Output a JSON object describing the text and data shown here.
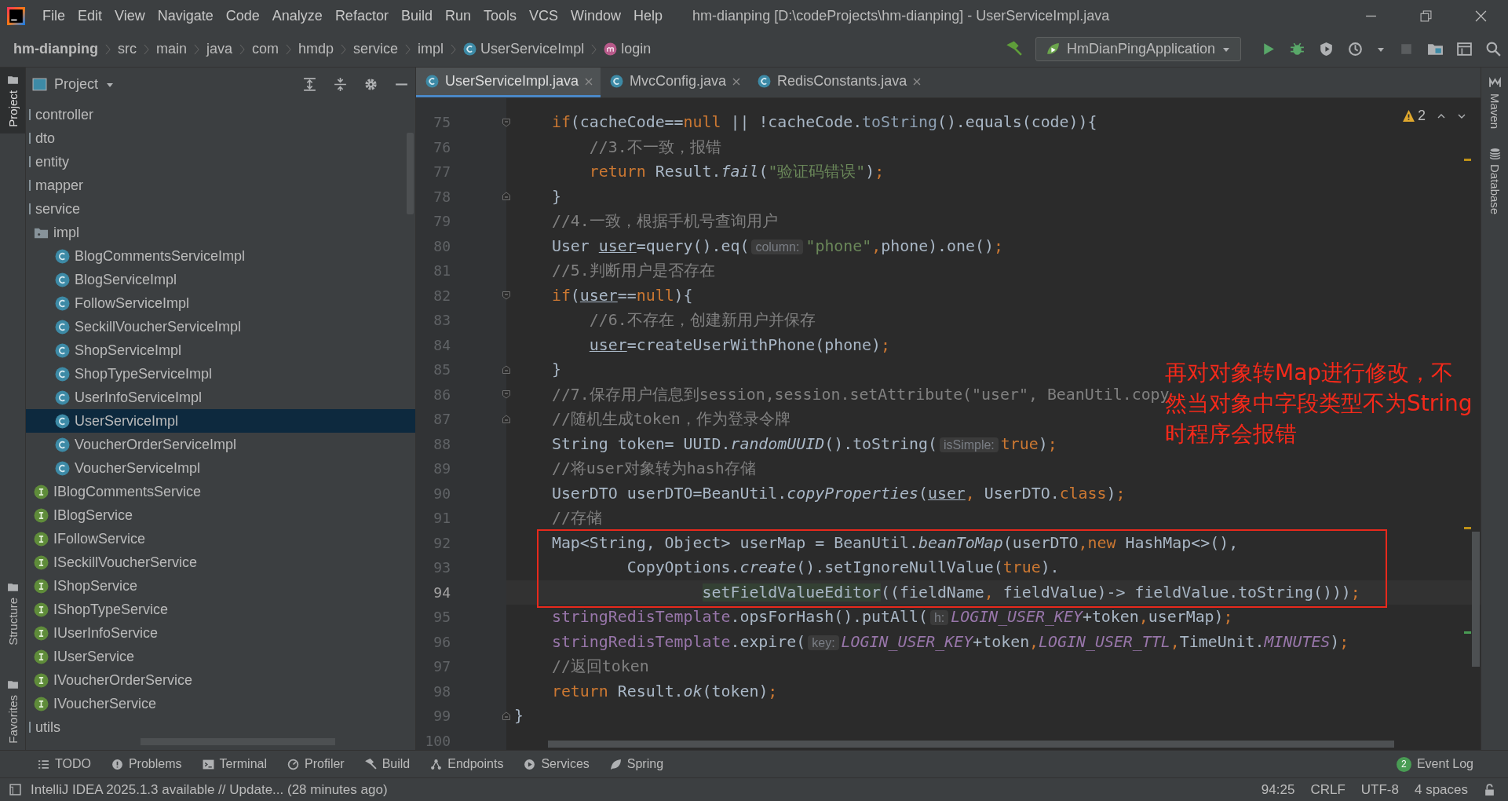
{
  "menu_bar": {
    "items": [
      "File",
      "Edit",
      "View",
      "Navigate",
      "Code",
      "Analyze",
      "Refactor",
      "Build",
      "Run",
      "Tools",
      "VCS",
      "Window",
      "Help"
    ],
    "title": "hm-dianping [D:\\codeProjects\\hm-dianping] - UserServiceImpl.java"
  },
  "breadcrumb": [
    {
      "label": "hm-dianping",
      "kind": "project"
    },
    {
      "label": "src",
      "kind": "folder"
    },
    {
      "label": "main",
      "kind": "folder"
    },
    {
      "label": "java",
      "kind": "folder"
    },
    {
      "label": "com",
      "kind": "folder"
    },
    {
      "label": "hmdp",
      "kind": "folder"
    },
    {
      "label": "service",
      "kind": "folder"
    },
    {
      "label": "impl",
      "kind": "folder"
    },
    {
      "label": "UserServiceImpl",
      "kind": "class"
    },
    {
      "label": "login",
      "kind": "method"
    }
  ],
  "run_configuration": {
    "label": "HmDianPingApplication"
  },
  "left_tool_strip": [
    {
      "label": "Project",
      "selected": true
    },
    {
      "label": "Structure",
      "selected": false
    },
    {
      "label": "Favorites",
      "selected": false
    }
  ],
  "project_panel": {
    "title": "Project",
    "tree": [
      {
        "label": "controller",
        "kind": "package",
        "selected": false
      },
      {
        "label": "dto",
        "kind": "package",
        "selected": false
      },
      {
        "label": "entity",
        "kind": "package",
        "selected": false
      },
      {
        "label": "mapper",
        "kind": "package",
        "selected": false
      },
      {
        "label": "service",
        "kind": "package",
        "selected": false,
        "children": [
          {
            "label": "impl",
            "kind": "folder",
            "selected": false,
            "children": [
              {
                "label": "BlogCommentsServiceImpl",
                "kind": "class",
                "selected": false
              },
              {
                "label": "BlogServiceImpl",
                "kind": "class",
                "selected": false
              },
              {
                "label": "FollowServiceImpl",
                "kind": "class",
                "selected": false
              },
              {
                "label": "SeckillVoucherServiceImpl",
                "kind": "class",
                "selected": false
              },
              {
                "label": "ShopServiceImpl",
                "kind": "class",
                "selected": false
              },
              {
                "label": "ShopTypeServiceImpl",
                "kind": "class",
                "selected": false
              },
              {
                "label": "UserInfoServiceImpl",
                "kind": "class",
                "selected": false
              },
              {
                "label": "UserServiceImpl",
                "kind": "class",
                "selected": true
              },
              {
                "label": "VoucherOrderServiceImpl",
                "kind": "class",
                "selected": false
              },
              {
                "label": "VoucherServiceImpl",
                "kind": "class",
                "selected": false
              }
            ]
          },
          {
            "label": "IBlogCommentsService",
            "kind": "interface",
            "selected": false
          },
          {
            "label": "IBlogService",
            "kind": "interface",
            "selected": false
          },
          {
            "label": "IFollowService",
            "kind": "interface",
            "selected": false
          },
          {
            "label": "ISeckillVoucherService",
            "kind": "interface",
            "selected": false
          },
          {
            "label": "IShopService",
            "kind": "interface",
            "selected": false
          },
          {
            "label": "IShopTypeService",
            "kind": "interface",
            "selected": false
          },
          {
            "label": "IUserInfoService",
            "kind": "interface",
            "selected": false
          },
          {
            "label": "IUserService",
            "kind": "interface",
            "selected": false
          },
          {
            "label": "IVoucherOrderService",
            "kind": "interface",
            "selected": false
          },
          {
            "label": "IVoucherService",
            "kind": "interface",
            "selected": false
          }
        ]
      },
      {
        "label": "utils",
        "kind": "package",
        "selected": false
      }
    ]
  },
  "editor_tabs": [
    {
      "label": "UserServiceImpl.java",
      "selected": true
    },
    {
      "label": "MvcConfig.java",
      "selected": false
    },
    {
      "label": "RedisConstants.java",
      "selected": false
    }
  ],
  "editor": {
    "warning_count": "2",
    "lines": [
      {
        "number": "75",
        "fold_start": true,
        "fold_end": false,
        "current": false,
        "boxed": false,
        "tokens": [
          {
            "kind": "keyword",
            "text": "    if"
          },
          {
            "kind": "plain",
            "text": "(cacheCode=="
          },
          {
            "kind": "keyword",
            "text": "null"
          },
          {
            "kind": "plain",
            "text": " || !cacheCode."
          },
          {
            "kind": "dim",
            "text": "toString"
          },
          {
            "kind": "plain",
            "text": "().equals(code)){"
          }
        ]
      },
      {
        "number": "76",
        "fold_start": false,
        "fold_end": false,
        "current": false,
        "boxed": false,
        "tokens": [
          {
            "kind": "comment",
            "text": "        //3.不一致，报错"
          }
        ]
      },
      {
        "number": "77",
        "fold_start": false,
        "fold_end": false,
        "current": false,
        "boxed": false,
        "tokens": [
          {
            "kind": "keyword",
            "text": "        return"
          },
          {
            "kind": "plain",
            "text": " Result."
          },
          {
            "kind": "italic",
            "text": "fail"
          },
          {
            "kind": "plain",
            "text": "("
          },
          {
            "kind": "string",
            "text": "\"验证码错误\""
          },
          {
            "kind": "plain",
            "text": ")"
          },
          {
            "kind": "keyword",
            "text": ";"
          }
        ]
      },
      {
        "number": "78",
        "fold_start": false,
        "fold_end": true,
        "current": false,
        "boxed": false,
        "tokens": [
          {
            "kind": "plain",
            "text": "    }"
          }
        ]
      },
      {
        "number": "79",
        "fold_start": false,
        "fold_end": false,
        "current": false,
        "boxed": false,
        "tokens": [
          {
            "kind": "comment",
            "text": "    //4.一致，根据手机号查询用户"
          }
        ]
      },
      {
        "number": "80",
        "fold_start": false,
        "fold_end": false,
        "current": false,
        "boxed": false,
        "tokens": [
          {
            "kind": "plain",
            "text": "    User "
          },
          {
            "kind": "underline",
            "text": "user"
          },
          {
            "kind": "plain",
            "text": "=query().eq("
          },
          {
            "kind": "hint",
            "text": "column:"
          },
          {
            "kind": "string",
            "text": "\"phone\""
          },
          {
            "kind": "keyword",
            "text": ","
          },
          {
            "kind": "plain",
            "text": "phone).one()"
          },
          {
            "kind": "keyword",
            "text": ";"
          }
        ]
      },
      {
        "number": "81",
        "fold_start": false,
        "fold_end": false,
        "current": false,
        "boxed": false,
        "tokens": [
          {
            "kind": "comment",
            "text": "    //5.判断用户是否存在"
          }
        ]
      },
      {
        "number": "82",
        "fold_start": true,
        "fold_end": false,
        "current": false,
        "boxed": false,
        "tokens": [
          {
            "kind": "keyword",
            "text": "    if"
          },
          {
            "kind": "plain",
            "text": "("
          },
          {
            "kind": "underline",
            "text": "user"
          },
          {
            "kind": "plain",
            "text": "=="
          },
          {
            "kind": "keyword",
            "text": "null"
          },
          {
            "kind": "plain",
            "text": "){"
          }
        ]
      },
      {
        "number": "83",
        "fold_start": false,
        "fold_end": false,
        "current": false,
        "boxed": false,
        "tokens": [
          {
            "kind": "comment",
            "text": "        //6.不存在，创建新用户并保存"
          }
        ]
      },
      {
        "number": "84",
        "fold_start": false,
        "fold_end": false,
        "current": false,
        "boxed": false,
        "tokens": [
          {
            "kind": "underline",
            "text": "        user"
          },
          {
            "kind": "plain",
            "text": "=createUserWithPhone(phone)"
          },
          {
            "kind": "keyword",
            "text": ";"
          }
        ]
      },
      {
        "number": "85",
        "fold_start": false,
        "fold_end": true,
        "current": false,
        "boxed": false,
        "tokens": [
          {
            "kind": "plain",
            "text": "    }"
          }
        ]
      },
      {
        "number": "86",
        "fold_start": true,
        "fold_end": false,
        "current": false,
        "boxed": false,
        "tokens": [
          {
            "kind": "comment",
            "text": "    //7.保存用户信息到session,session.setAttribute(\"user\", BeanUtil.copy"
          }
        ]
      },
      {
        "number": "87",
        "fold_start": false,
        "fold_end": true,
        "current": false,
        "boxed": false,
        "tokens": [
          {
            "kind": "comment",
            "text": "    //随机生成token，作为登录令牌"
          }
        ]
      },
      {
        "number": "88",
        "fold_start": false,
        "fold_end": false,
        "current": false,
        "boxed": false,
        "tokens": [
          {
            "kind": "plain",
            "text": "    String token= UUID."
          },
          {
            "kind": "italic",
            "text": "randomUUID"
          },
          {
            "kind": "plain",
            "text": "().toString("
          },
          {
            "kind": "hint",
            "text": "isSimple:"
          },
          {
            "kind": "keyword",
            "text": "true"
          },
          {
            "kind": "plain",
            "text": ")"
          },
          {
            "kind": "keyword",
            "text": ";"
          }
        ]
      },
      {
        "number": "89",
        "fold_start": false,
        "fold_end": false,
        "current": false,
        "boxed": false,
        "tokens": [
          {
            "kind": "comment",
            "text": "    //将user对象转为hash存储"
          }
        ]
      },
      {
        "number": "90",
        "fold_start": false,
        "fold_end": false,
        "current": false,
        "boxed": false,
        "tokens": [
          {
            "kind": "plain",
            "text": "    UserDTO userDTO=BeanUtil."
          },
          {
            "kind": "italic",
            "text": "copyProperties"
          },
          {
            "kind": "plain",
            "text": "("
          },
          {
            "kind": "underline",
            "text": "user"
          },
          {
            "kind": "keyword",
            "text": ","
          },
          {
            "kind": "plain",
            "text": " UserDTO."
          },
          {
            "kind": "keyword",
            "text": "class"
          },
          {
            "kind": "plain",
            "text": ")"
          },
          {
            "kind": "keyword",
            "text": ";"
          }
        ]
      },
      {
        "number": "91",
        "fold_start": false,
        "fold_end": false,
        "current": false,
        "boxed": false,
        "tokens": [
          {
            "kind": "comment",
            "text": "    //存储"
          }
        ]
      },
      {
        "number": "92",
        "fold_start": false,
        "fold_end": false,
        "current": false,
        "boxed": true,
        "tokens": [
          {
            "kind": "plain",
            "text": "    Map<String, Object> userMap = BeanUtil."
          },
          {
            "kind": "italic",
            "text": "beanToMap"
          },
          {
            "kind": "plain",
            "text": "(userDTO"
          },
          {
            "kind": "keyword",
            "text": ",new"
          },
          {
            "kind": "plain",
            "text": " HashMap<>(),"
          }
        ]
      },
      {
        "number": "93",
        "fold_start": false,
        "fold_end": false,
        "current": false,
        "boxed": true,
        "tokens": [
          {
            "kind": "plain",
            "text": "            CopyOptions."
          },
          {
            "kind": "italic",
            "text": "create"
          },
          {
            "kind": "plain",
            "text": "().setIgnoreNullValue("
          },
          {
            "kind": "keyword",
            "text": "true"
          },
          {
            "kind": "plain",
            "text": ")."
          }
        ]
      },
      {
        "number": "94",
        "fold_start": false,
        "fold_end": false,
        "current": true,
        "boxed": true,
        "tokens": [
          {
            "kind": "usage",
            "text": "                    setFieldValueEditor"
          },
          {
            "kind": "plain",
            "text": "((fieldName"
          },
          {
            "kind": "keyword",
            "text": ","
          },
          {
            "kind": "plain",
            "text": " fieldValue)-> fieldValue.toString()))"
          },
          {
            "kind": "keyword",
            "text": ";"
          }
        ]
      },
      {
        "number": "95",
        "fold_start": false,
        "fold_end": false,
        "current": false,
        "boxed": false,
        "tokens": [
          {
            "kind": "field",
            "text": "    stringRedisTemplate"
          },
          {
            "kind": "plain",
            "text": ".opsForHash().putAll("
          },
          {
            "kind": "hint",
            "text": "h:"
          },
          {
            "kind": "constant",
            "text": "LOGIN_USER_KEY"
          },
          {
            "kind": "plain",
            "text": "+token"
          },
          {
            "kind": "keyword",
            "text": ","
          },
          {
            "kind": "plain",
            "text": "userMap)"
          },
          {
            "kind": "keyword",
            "text": ";"
          }
        ]
      },
      {
        "number": "96",
        "fold_start": false,
        "fold_end": false,
        "current": false,
        "boxed": false,
        "tokens": [
          {
            "kind": "field",
            "text": "    stringRedisTemplate"
          },
          {
            "kind": "plain",
            "text": ".expire("
          },
          {
            "kind": "hint",
            "text": "key:"
          },
          {
            "kind": "constant",
            "text": "LOGIN_USER_KEY"
          },
          {
            "kind": "plain",
            "text": "+token"
          },
          {
            "kind": "keyword",
            "text": ","
          },
          {
            "kind": "constant",
            "text": "LOGIN_USER_TTL"
          },
          {
            "kind": "keyword",
            "text": ","
          },
          {
            "kind": "plain",
            "text": "TimeUnit."
          },
          {
            "kind": "constant",
            "text": "MINUTES"
          },
          {
            "kind": "plain",
            "text": ")"
          },
          {
            "kind": "keyword",
            "text": ";"
          }
        ]
      },
      {
        "number": "97",
        "fold_start": false,
        "fold_end": false,
        "current": false,
        "boxed": false,
        "tokens": [
          {
            "kind": "comment",
            "text": "    //返回token"
          }
        ]
      },
      {
        "number": "98",
        "fold_start": false,
        "fold_end": false,
        "current": false,
        "boxed": false,
        "tokens": [
          {
            "kind": "keyword",
            "text": "    return"
          },
          {
            "kind": "plain",
            "text": " Result."
          },
          {
            "kind": "italic",
            "text": "ok"
          },
          {
            "kind": "plain",
            "text": "(token)"
          },
          {
            "kind": "keyword",
            "text": ";"
          }
        ]
      },
      {
        "number": "99",
        "fold_start": false,
        "fold_end": true,
        "current": false,
        "boxed": false,
        "tokens": [
          {
            "kind": "plain",
            "text": "}"
          }
        ]
      },
      {
        "number": "100",
        "fold_start": false,
        "fold_end": false,
        "current": false,
        "boxed": false
      }
    ],
    "annotation": {
      "lines": [
        "再对对象转Map进行修改，不",
        "然当对象中字段类型不为String",
        "时程序会报错"
      ]
    }
  },
  "right_tool_strip": [
    {
      "label": "Maven",
      "kind": "maven"
    },
    {
      "label": "Database",
      "kind": "database"
    }
  ],
  "bottom_tools": [
    {
      "label": "TODO",
      "kind": "todo"
    },
    {
      "label": "Problems",
      "kind": "problems"
    },
    {
      "label": "Terminal",
      "kind": "terminal"
    },
    {
      "label": "Profiler",
      "kind": "profiler"
    },
    {
      "label": "Build",
      "kind": "build"
    },
    {
      "label": "Endpoints",
      "kind": "endpoints"
    },
    {
      "label": "Services",
      "kind": "services"
    },
    {
      "label": "Spring",
      "kind": "spring"
    }
  ],
  "event_log": {
    "label": "Event Log",
    "badge": "2"
  },
  "status_bar": {
    "message": "IntelliJ IDEA 2025.1.3 available // Update... (28 minutes ago)",
    "items": [
      "94:25",
      "CRLF",
      "UTF-8",
      "4 spaces"
    ]
  }
}
